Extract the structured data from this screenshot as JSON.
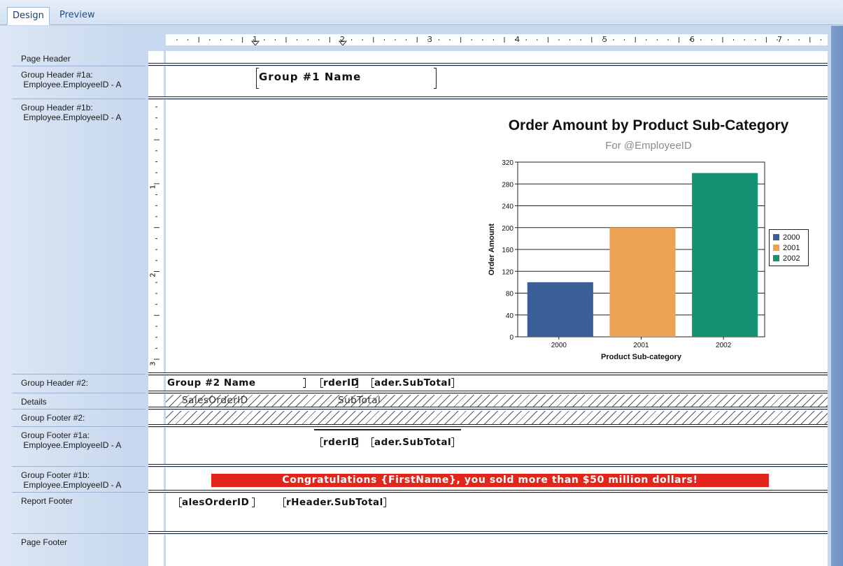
{
  "tabs": [
    {
      "label": "Design"
    },
    {
      "label": "Preview"
    }
  ],
  "ruler": {
    "numbers": [
      "1",
      "2",
      "3",
      "4",
      "5",
      "6",
      "7"
    ],
    "vertical_numbers": [
      "1",
      "2",
      "3"
    ]
  },
  "sections": {
    "page_header": "Page Header",
    "group_header_1a": "Group Header #1a:\n Employee.EmployeeID - A",
    "group_header_1b": "Group Header #1b:\n Employee.EmployeeID - A",
    "group_header_2": "Group Header #2:",
    "details": "Details",
    "group_footer_2": "Group Footer #2:",
    "group_footer_1a": "Group Footer #1a:\n Employee.EmployeeID - A",
    "group_footer_1b": "Group Footer #1b:\n Employee.EmployeeID - A",
    "report_footer": "Report Footer",
    "page_footer": "Page Footer"
  },
  "fields": {
    "group1_name": "Group #1 Name",
    "group2_name": "Group #2 Name",
    "gh2_orderid": "rderID",
    "gh2_subtotal": "ader.SubTotal",
    "details_salesorderid": "SalesOrderID",
    "details_subtotal": "SubTotal",
    "gf1a_orderid": "rderID",
    "gf1a_subtotal": "ader.SubTotal",
    "rf_salesorderid": "alesOrderID",
    "rf_subtotal": "rHeader.SubTotal"
  },
  "banner": "Congratulations {FirstName}, you sold more than $50 million dollars!",
  "chart_data": {
    "type": "bar",
    "title": "Order Amount by Product Sub-Category",
    "subtitle": "For @EmployeeID",
    "xlabel": "Product Sub-category",
    "ylabel": "Order Amount",
    "categories": [
      "2000",
      "2001",
      "2002"
    ],
    "series": [
      {
        "name": "2000",
        "values": [
          100,
          null,
          null
        ],
        "color": "#3a5f96"
      },
      {
        "name": "2001",
        "values": [
          null,
          200,
          null
        ],
        "color": "#eda354"
      },
      {
        "name": "2002",
        "values": [
          null,
          null,
          300
        ],
        "color": "#159271"
      }
    ],
    "ylim": [
      0,
      320
    ],
    "yticks": [
      "0",
      "40",
      "80",
      "120",
      "160",
      "200",
      "240",
      "280",
      "320"
    ],
    "grid": true,
    "legend_position": "right"
  }
}
